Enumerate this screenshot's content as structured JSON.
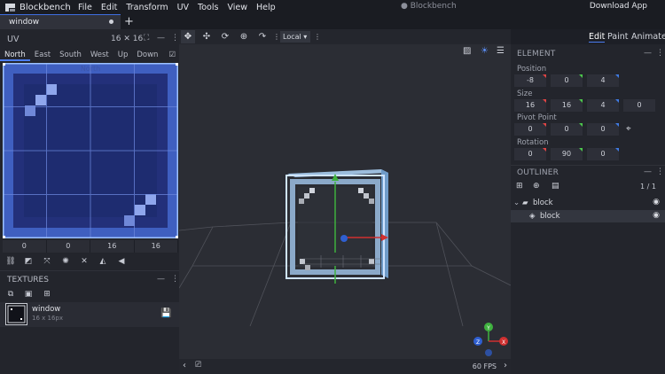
{
  "app": {
    "name": "Blockbench",
    "project_title": "● Blockbench",
    "download_label": "Download App"
  },
  "menu": [
    "File",
    "Edit",
    "Transform",
    "UV",
    "Tools",
    "View",
    "Help"
  ],
  "tab": {
    "label": "window",
    "add_label": "+"
  },
  "uv_panel": {
    "title": "UV",
    "texture_size": "16 ✕ 16",
    "faces": [
      "North",
      "East",
      "South",
      "West",
      "Up",
      "Down"
    ],
    "active_face": "North",
    "editor_label": "North",
    "inputs": [
      "0",
      "0",
      "16",
      "16"
    ]
  },
  "textures_panel": {
    "title": "TEXTURES",
    "items": [
      {
        "name": "window",
        "dims": "16 x 16px"
      }
    ]
  },
  "viewport": {
    "space": "Local",
    "fps": "60 FPS",
    "gizmo_axes": [
      "Y",
      "X",
      "Z"
    ]
  },
  "modes": [
    "Edit",
    "Paint",
    "Animate"
  ],
  "active_mode": "Edit",
  "element_panel": {
    "title": "ELEMENT",
    "position": {
      "label": "Position",
      "values": [
        "-8",
        "0",
        "4"
      ]
    },
    "size": {
      "label": "Size",
      "values": [
        "16",
        "16",
        "4",
        "0"
      ]
    },
    "pivot": {
      "label": "Pivot Point",
      "values": [
        "0",
        "0",
        "0"
      ]
    },
    "rotation": {
      "label": "Rotation",
      "values": [
        "0",
        "90",
        "0"
      ]
    }
  },
  "outliner": {
    "title": "OUTLINER",
    "count": "1 / 1",
    "group": "block",
    "cube": "block"
  },
  "colors": {
    "accent": "#4b7cf0",
    "uv_fill": "#1b2a6b",
    "selection": "#7fb0f5"
  }
}
